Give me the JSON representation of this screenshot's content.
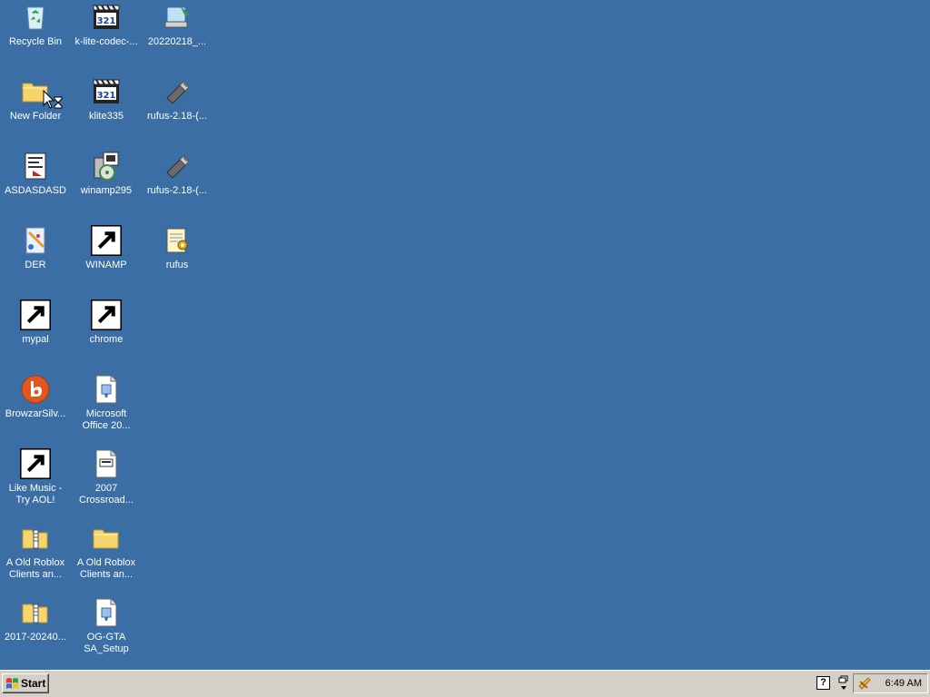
{
  "desktop": {
    "icons": [
      {
        "label": "Recycle Bin",
        "icon": "recycle-bin-icon"
      },
      {
        "label": "k-lite-codec-...",
        "icon": "media-player-classic-icon"
      },
      {
        "label": "20220218_...",
        "icon": "computer-installer-icon"
      },
      {
        "label": "New Folder",
        "icon": "folder-icon"
      },
      {
        "label": "klite335",
        "icon": "media-player-classic-icon"
      },
      {
        "label": "rufus-2.18-(...",
        "icon": "usb-drive-icon"
      },
      {
        "label": "ASDASDASD",
        "icon": "document-icon"
      },
      {
        "label": "winamp295",
        "icon": "installer-cd-icon"
      },
      {
        "label": "rufus-2.18-(...",
        "icon": "usb-drive-icon"
      },
      {
        "label": "DER",
        "icon": "paint-document-icon"
      },
      {
        "label": "WINAMP",
        "icon": "winamp-icon"
      },
      {
        "label": "rufus",
        "icon": "notepad-config-icon"
      },
      {
        "label": "mypal",
        "icon": "raccoon-browser-icon"
      },
      {
        "label": "chrome",
        "icon": "chrome-icon"
      },
      {
        "label": "BrowzarSilv...",
        "icon": "browzar-icon"
      },
      {
        "label": "Microsoft Office 20...",
        "icon": "office-setup-file-icon"
      },
      {
        "label": "Like Music - Try AOL!",
        "icon": "aol-music-icon"
      },
      {
        "label": "2007 Crossroad...",
        "icon": "text-file-icon"
      },
      {
        "label": "A Old Roblox Clients an...",
        "icon": "zip-folder-icon"
      },
      {
        "label": "A Old Roblox Clients an...",
        "icon": "folder-icon"
      },
      {
        "label": "2017-20240...",
        "icon": "zip-folder-icon"
      },
      {
        "label": "OG-GTA SA_Setup",
        "icon": "setup-file-icon"
      }
    ]
  },
  "taskbar": {
    "start_label": "Start",
    "help_label": "?",
    "clock": "6:49 AM"
  },
  "colors": {
    "desktop": "#3a6ea5",
    "taskbar": "#d4d0c8"
  }
}
